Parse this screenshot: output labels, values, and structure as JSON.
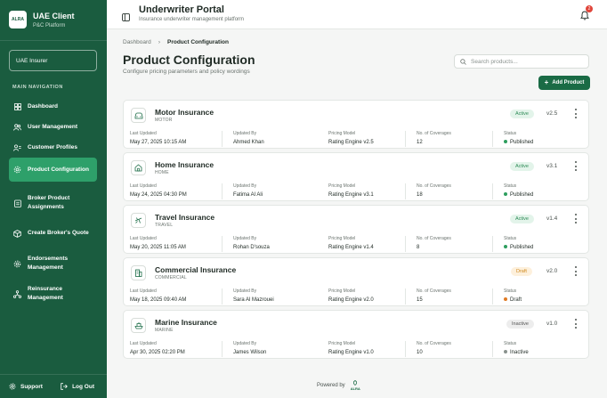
{
  "sidebar": {
    "brand_title": "UAE Client",
    "brand_sub": "P&C Platform",
    "brand_logo_text": "ALRA",
    "tenant": "UAE Insurer",
    "nav_heading": "MAIN NAVIGATION",
    "items": [
      {
        "label": "Dashboard",
        "icon": "grid-icon"
      },
      {
        "label": "User Management",
        "icon": "users-icon"
      },
      {
        "label": "Customer Profiles",
        "icon": "user-cards-icon"
      },
      {
        "label": "Product Configuration",
        "icon": "gear-icon",
        "active": true
      },
      {
        "label": "Broker Product Assignments",
        "icon": "clipboard-icon"
      },
      {
        "label": "Create Broker's Quote",
        "icon": "box-icon"
      },
      {
        "label": "Endorsements Management",
        "icon": "gear-icon"
      },
      {
        "label": "Reinsurance Management",
        "icon": "network-icon"
      }
    ],
    "support": "Support",
    "logout": "Log Out"
  },
  "header": {
    "title": "Underwriter Portal",
    "subtitle": "Insurance underwriter management platform",
    "notification_count": "2"
  },
  "breadcrumb": {
    "root": "Dashboard",
    "current": "Product Configuration"
  },
  "page": {
    "title": "Product Configuration",
    "subtitle": "Configure pricing parameters and policy wordings",
    "search_placeholder": "Search products...",
    "add_label": "Add Product"
  },
  "field_labels": {
    "last_updated": "Last Updated",
    "updated_by": "Updated By",
    "pricing_model": "Pricing Model",
    "coverages": "No. of Coverages",
    "status": "Status"
  },
  "products": [
    {
      "name": "Motor Insurance",
      "code": "MOTOR",
      "icon": "car-icon",
      "badge": "Active",
      "badge_type": "active",
      "version": "v2.5",
      "last_updated": "May 27, 2025 10:15 AM",
      "updated_by": "Ahmed Khan",
      "pricing_model": "Rating Engine v2.5",
      "coverages": "12",
      "status": "Published",
      "status_color": "#2e9e5e"
    },
    {
      "name": "Home Insurance",
      "code": "HOME",
      "icon": "home-icon",
      "badge": "Active",
      "badge_type": "active",
      "version": "v3.1",
      "last_updated": "May 24, 2025 04:30 PM",
      "updated_by": "Fatima Al Ali",
      "pricing_model": "Rating Engine v3.1",
      "coverages": "18",
      "status": "Published",
      "status_color": "#2e9e5e"
    },
    {
      "name": "Travel Insurance",
      "code": "TRAVEL",
      "icon": "plane-icon",
      "badge": "Active",
      "badge_type": "active",
      "version": "v1.4",
      "last_updated": "May 20, 2025 11:05 AM",
      "updated_by": "Rohan D'souza",
      "pricing_model": "Rating Engine v1.4",
      "coverages": "8",
      "status": "Published",
      "status_color": "#2e9e5e"
    },
    {
      "name": "Commercial Insurance",
      "code": "COMMERCIAL",
      "icon": "building-icon",
      "badge": "Draft",
      "badge_type": "draft",
      "version": "v2.0",
      "last_updated": "May 18, 2025 09:40 AM",
      "updated_by": "Sara Al Mazrouei",
      "pricing_model": "Rating Engine v2.0",
      "coverages": "15",
      "status": "Draft",
      "status_color": "#e07a24"
    },
    {
      "name": "Marine Insurance",
      "code": "MARINE",
      "icon": "ship-icon",
      "badge": "Inactive",
      "badge_type": "inactive",
      "version": "v1.0",
      "last_updated": "Apr 30, 2025 02:20 PM",
      "updated_by": "James Wilson",
      "pricing_model": "Rating Engine v1.0",
      "coverages": "10",
      "status": "Inactive",
      "status_color": "#8a928e"
    }
  ],
  "footer": {
    "powered_by": "Powered by",
    "logo_text": "ALRA"
  },
  "colors": {
    "sidebar": "#1a5c3f",
    "accent": "#2ea06a",
    "primary_button": "#1a6b45"
  }
}
